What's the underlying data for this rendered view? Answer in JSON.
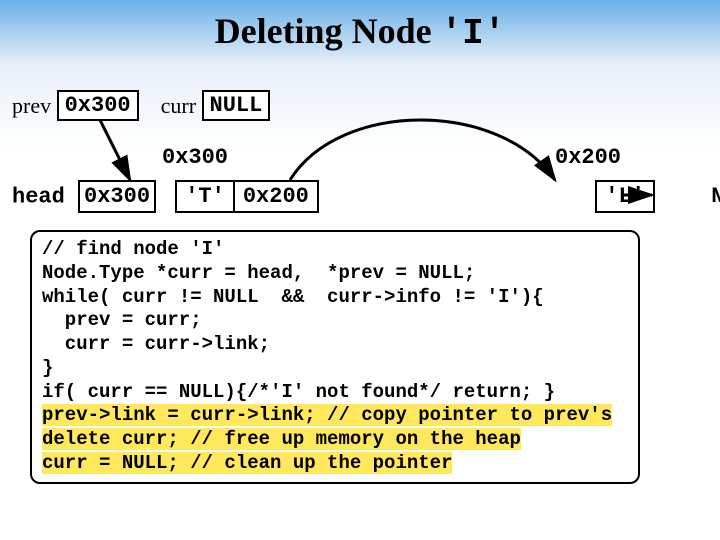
{
  "title_plain": "Deleting Node ",
  "title_mono": "'I'",
  "prev": {
    "label": "prev",
    "value": "0x300"
  },
  "curr": {
    "label": "curr",
    "value": "NULL"
  },
  "addr1": "0x300",
  "addr2": "0x200",
  "head": {
    "label": "head",
    "value": "0x300"
  },
  "node1": {
    "info": "'T'",
    "link": "0x200"
  },
  "node2": {
    "info": "'L'"
  },
  "null_tail": "NULL",
  "code": {
    "l1": "// find node 'I'",
    "l2": "Node.Type *curr = head,  *prev = NULL;",
    "l3": "while( curr != NULL  &&  curr->info != 'I'){",
    "l4": "  prev = curr;",
    "l5": "  curr = curr->link;",
    "l6": "}",
    "l7": "if( curr == NULL){/*'I' not found*/ return; }",
    "l8": "prev->link = curr->link; // copy pointer to prev's",
    "l9": "delete curr; // free up memory on the heap",
    "l10": "curr = NULL; // clean up the pointer"
  }
}
